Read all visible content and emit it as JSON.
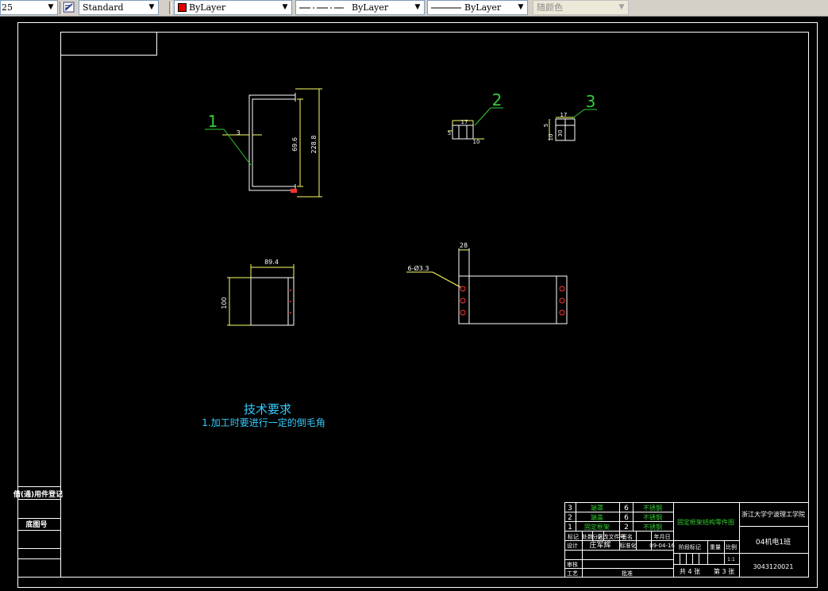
{
  "toolbar": {
    "scale_value": "25",
    "text_style": "Standard",
    "color": "ByLayer",
    "color_swatch": "#e00000",
    "linetype": "ByLayer",
    "lineweight": "ByLayer",
    "plot_style": "随颜色"
  },
  "drawing": {
    "part_labels": [
      "1",
      "2",
      "3"
    ],
    "dims_part1": [
      "3",
      "69.6",
      "228.8"
    ],
    "dims_part2": [
      "17",
      "5",
      "10"
    ],
    "dims_part3": [
      "17",
      "5",
      "10",
      "30"
    ],
    "dims_front": [
      "89.4",
      "100"
    ],
    "dims_side": [
      "28",
      "6-Ø3.3"
    ],
    "tech_title": "技术要求",
    "tech_note": "1.加工时要进行一定的倒毛角"
  },
  "left_strip": {
    "label1": "借(通)用件登记",
    "label2": "底图号"
  },
  "title_block": {
    "parts": [
      {
        "no": "3",
        "name": "端罩",
        "qty": "6",
        "material": "不锈钢"
      },
      {
        "no": "2",
        "name": "端盖",
        "qty": "6",
        "material": "不锈钢"
      },
      {
        "no": "1",
        "name": "固定框架",
        "qty": "2",
        "material": "不锈钢"
      }
    ],
    "header": [
      "标记",
      "处数",
      "分区",
      "更改文件号",
      "签名",
      "年月日"
    ],
    "design_label": "设计",
    "designer": "庄军辉",
    "std_label": "标准化",
    "date": "09-04-16",
    "check_label": "审核",
    "process_label": "工艺",
    "approve_label": "批准",
    "drawing_name": "固定框架结构零件图",
    "school": "浙江大学宁波理工学院",
    "class": "04机电1班",
    "student_no": "3043120021",
    "stage_label": "阶段标记",
    "weight_label": "重量",
    "scale_label": "比例",
    "scale_value": "1:1",
    "total_sheets": "共 4 张",
    "sheet_no": "第 3 张"
  }
}
